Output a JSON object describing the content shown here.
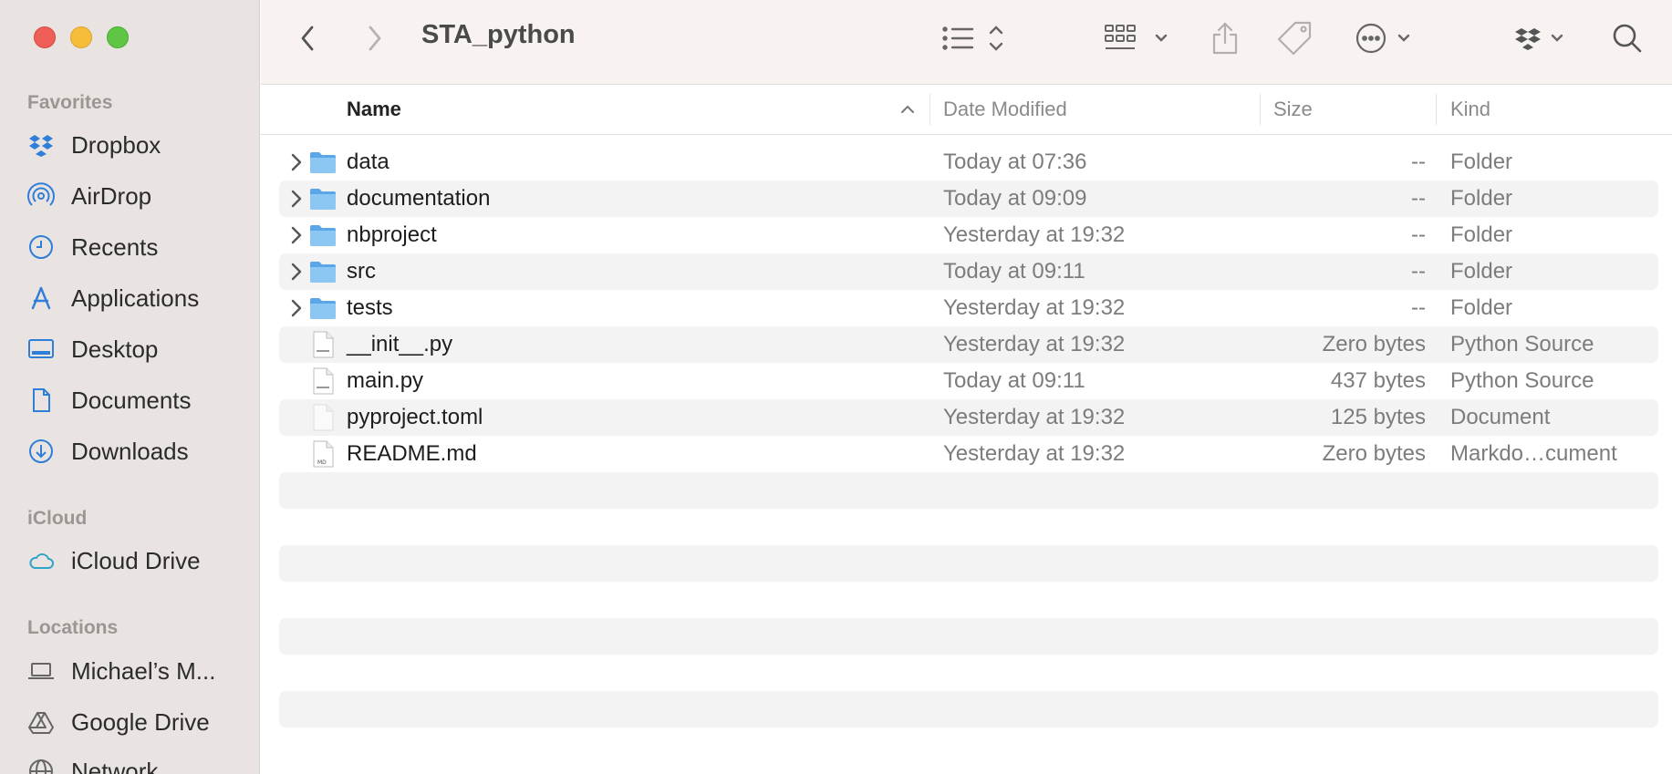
{
  "window": {
    "title": "STA_python"
  },
  "sidebar": {
    "sections": [
      {
        "heading": "Favorites",
        "items": [
          {
            "label": "Dropbox",
            "icon": "dropbox-icon"
          },
          {
            "label": "AirDrop",
            "icon": "airdrop-icon"
          },
          {
            "label": "Recents",
            "icon": "clock-icon"
          },
          {
            "label": "Applications",
            "icon": "applications-icon"
          },
          {
            "label": "Desktop",
            "icon": "desktop-icon"
          },
          {
            "label": "Documents",
            "icon": "document-icon"
          },
          {
            "label": "Downloads",
            "icon": "download-icon"
          }
        ]
      },
      {
        "heading": "iCloud",
        "items": [
          {
            "label": "iCloud Drive",
            "icon": "cloud-icon"
          }
        ]
      },
      {
        "heading": "Locations",
        "items": [
          {
            "label": "Michael’s M...",
            "icon": "laptop-icon"
          },
          {
            "label": "Google Drive",
            "icon": "google-drive-icon"
          },
          {
            "label": "Network",
            "icon": "network-icon"
          }
        ]
      }
    ]
  },
  "columns": {
    "name": "Name",
    "date": "Date Modified",
    "size": "Size",
    "kind": "Kind"
  },
  "files": [
    {
      "name": "data",
      "date": "Today at 07:36",
      "size": "--",
      "kind": "Folder",
      "type": "folder"
    },
    {
      "name": "documentation",
      "date": "Today at 09:09",
      "size": "--",
      "kind": "Folder",
      "type": "folder"
    },
    {
      "name": "nbproject",
      "date": "Yesterday at 19:32",
      "size": "--",
      "kind": "Folder",
      "type": "folder"
    },
    {
      "name": "src",
      "date": "Today at 09:11",
      "size": "--",
      "kind": "Folder",
      "type": "folder"
    },
    {
      "name": "tests",
      "date": "Yesterday at 19:32",
      "size": "--",
      "kind": "Folder",
      "type": "folder"
    },
    {
      "name": "__init__.py",
      "date": "Yesterday at 19:32",
      "size": "Zero bytes",
      "kind": "Python Source",
      "type": "python"
    },
    {
      "name": "main.py",
      "date": "Today at 09:11",
      "size": "437 bytes",
      "kind": "Python Source",
      "type": "python"
    },
    {
      "name": "pyproject.toml",
      "date": "Yesterday at 19:32",
      "size": "125 bytes",
      "kind": "Document",
      "type": "doc"
    },
    {
      "name": "README.md",
      "date": "Yesterday at 19:32",
      "size": "Zero bytes",
      "kind": "Markdo…cument",
      "type": "md"
    }
  ],
  "colors": {
    "accent": "#2f7ed8",
    "folder": "#7ab8ec",
    "sidebar_bg": "#e9e4e1"
  }
}
